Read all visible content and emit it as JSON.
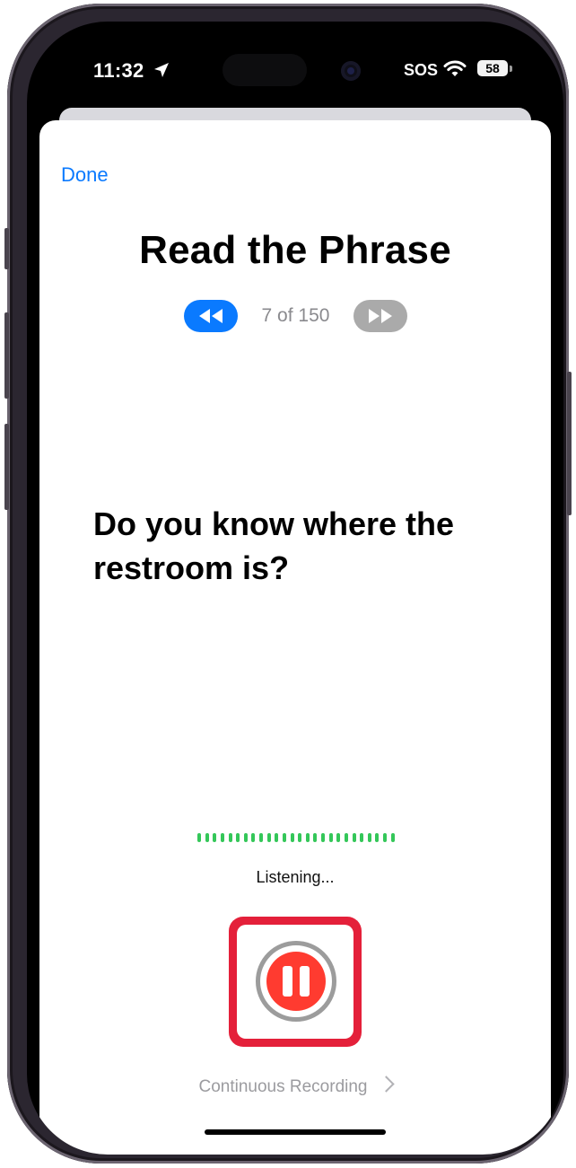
{
  "status_bar": {
    "time": "11:32",
    "location_icon": "location-arrow-icon",
    "carrier_text": "SOS",
    "wifi_icon": "wifi-icon",
    "battery_level": "58"
  },
  "header": {
    "done_label": "Done"
  },
  "page": {
    "title": "Read the Phrase",
    "counter": "7 of 150",
    "prev_icon": "rewind-icon",
    "next_icon": "fast-forward-icon"
  },
  "phrase": {
    "text": "Do you know where the restroom is?"
  },
  "recording": {
    "status_text": "Listening...",
    "button_icon": "pause-icon",
    "level_bar_count": 26,
    "level_color": "#34c759",
    "button_color": "#ff3b30",
    "highlight_color": "#e4203a"
  },
  "footer": {
    "continuous_label": "Continuous Recording",
    "chevron_icon": "chevron-right-icon"
  },
  "colors": {
    "accent": "#0a7aff",
    "disabled": "#aaaaaa"
  }
}
